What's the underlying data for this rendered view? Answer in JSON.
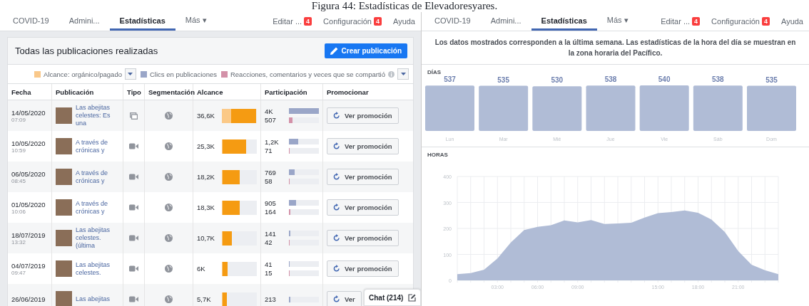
{
  "caption": "Figura 44: Estadísticas de Elevadoresyares.",
  "left": {
    "nav": {
      "tabs": [
        {
          "label": "COVID-19",
          "selected": false
        },
        {
          "label": "Admini...",
          "selected": false
        },
        {
          "label": "Estadísticas",
          "selected": true
        },
        {
          "label": "Más ▾",
          "selected": false
        }
      ],
      "actions": [
        {
          "label": "Editar ...",
          "badge": "4"
        },
        {
          "label": "Configuración",
          "badge": "4"
        },
        {
          "label": "Ayuda"
        }
      ]
    },
    "card": {
      "title": "Todas las publicaciones realizadas",
      "create_button": "Crear publicación",
      "legend": [
        {
          "label": "Alcance: orgánico/pagado",
          "color": "#f9c88a",
          "dropdown": true
        },
        {
          "label": "Clics en publicaciones",
          "color": "#9aa6c8",
          "dropdown": false
        },
        {
          "label": "Reacciones, comentarios y veces que se compartió",
          "color": "#d391a8",
          "info": true,
          "dropdown": true
        }
      ],
      "table": {
        "columns": [
          "Fecha",
          "Publicación",
          "Tipo",
          "Segmentación",
          "Alcance",
          "Participación",
          "Promocionar"
        ],
        "rows": [
          {
            "date": "14/05/2020",
            "time": "07:09",
            "title": "Las abejitas celestes: Es una",
            "kind": "album",
            "reach": "36,6K",
            "organic_bar": {
              "level": 0.26
            },
            "paid_bar": {
              "level": 0.72
            },
            "clicks": "4K",
            "clicks_bar": {
              "level": 1
            },
            "reactions": "507",
            "reactions_bar": {
              "level": 0.13
            },
            "button": "Ver promoción"
          },
          {
            "date": "10/05/2020",
            "time": "10:59",
            "title": "A través de crónicas y",
            "kind": "video",
            "reach": "25,3K",
            "organic_bar": {
              "level": 0.02
            },
            "paid_bar": {
              "level": 0.68
            },
            "clicks": "1,2K",
            "clicks_bar": {
              "level": 0.3
            },
            "reactions": "71",
            "reactions_bar": {
              "level": 0.02
            },
            "button": "Ver promoción"
          },
          {
            "date": "06/05/2020",
            "time": "08:45",
            "title": "A través de crónicas y",
            "kind": "video",
            "reach": "18,2K",
            "organic_bar": {
              "level": 0.02
            },
            "paid_bar": {
              "level": 0.48
            },
            "clicks": "769",
            "clicks_bar": {
              "level": 0.19
            },
            "reactions": "58",
            "reactions_bar": {
              "level": 0.02
            },
            "button": "Ver promoción"
          },
          {
            "date": "01/05/2020",
            "time": "10:06",
            "title": "A través de crónicas y",
            "kind": "video",
            "reach": "18,3K",
            "organic_bar": {
              "level": 0.02
            },
            "paid_bar": {
              "level": 0.48
            },
            "clicks": "905",
            "clicks_bar": {
              "level": 0.23
            },
            "reactions": "164",
            "reactions_bar": {
              "level": 0.04
            },
            "button": "Ver promoción"
          },
          {
            "date": "18/07/2019",
            "time": "13:32",
            "title": "Las abejitas celestes. (última",
            "kind": "video",
            "reach": "10,7K",
            "organic_bar": {
              "level": 0.02
            },
            "paid_bar": {
              "level": 0.27
            },
            "clicks": "141",
            "clicks_bar": {
              "level": 0.04
            },
            "reactions": "42",
            "reactions_bar": {
              "level": 0.02
            },
            "button": "Ver promoción"
          },
          {
            "date": "04/07/2019",
            "time": "09:47",
            "title": "Las abejitas celestes.",
            "kind": "video",
            "reach": "6K",
            "organic_bar": {
              "level": 0.02
            },
            "paid_bar": {
              "level": 0.14
            },
            "clicks": "41",
            "clicks_bar": {
              "level": 0.01
            },
            "reactions": "15",
            "reactions_bar": {
              "level": 0.01
            },
            "button": "Ver promoción"
          },
          {
            "date": "26/06/2019",
            "title": "Las abejitas",
            "kind": "video",
            "reach": "5,7K",
            "organic_bar": {
              "level": 0.02
            },
            "paid_bar": {
              "level": 0.13
            },
            "clicks": "213",
            "clicks_bar": {
              "level": 0.05
            },
            "button": "Ver"
          }
        ]
      }
    },
    "chat": {
      "label": "Chat (214)"
    }
  },
  "right": {
    "nav": {
      "tabs": [
        {
          "label": "COVID-19",
          "selected": false
        },
        {
          "label": "Admini...",
          "selected": false
        },
        {
          "label": "Estadísticas",
          "selected": true
        },
        {
          "label": "Más ▾",
          "selected": false
        }
      ],
      "actions": [
        {
          "label": "Editar ...",
          "badge": "4"
        },
        {
          "label": "Configuración",
          "badge": "4"
        },
        {
          "label": "Ayuda"
        }
      ]
    },
    "notice": "Los datos mostrados corresponden a la última semana. Las estadísticas de la hora del día se muestran en la zona horaria del Pacífico.",
    "days": {
      "chart_data": {
        "type": "bar",
        "categories": [
          "Lun",
          "Mar",
          "Mié",
          "Jue",
          "Vie",
          "Sáb",
          "Dom"
        ],
        "series": [
          {
            "name": "DÍAS",
            "color": "#b0bcd6",
            "values": [
              537,
              535,
              530,
              538,
              540,
              538,
              535
            ]
          }
        ],
        "data_labels": true
      }
    },
    "hours": {
      "chart_data": {
        "type": "area",
        "grid": true,
        "x": [
          0,
          1,
          2,
          3,
          4,
          5,
          6,
          7,
          8,
          9,
          10,
          11,
          12,
          13,
          14,
          15,
          16,
          17,
          18,
          19,
          20,
          21,
          22,
          23,
          24
        ],
        "series": [
          {
            "name": "HORAS",
            "color": "#b0bcd6",
            "values": [
              24,
              28,
              41,
              84,
              146,
              194,
              206,
              212,
              231,
              223,
              232,
              217,
              219,
              222,
              242,
              259,
              263,
              269,
              260,
              234,
              186,
              113,
              60,
              39,
              24
            ]
          }
        ],
        "xlim": [
          0,
          24
        ],
        "ylim": [
          0,
          400
        ],
        "yticks": [
          0,
          100,
          200,
          300,
          400
        ],
        "xticks": [
          {
            "value": 3,
            "label": "03:00"
          },
          {
            "value": 6,
            "label": "06:00"
          },
          {
            "value": 9,
            "label": "09:00"
          },
          {
            "value": 15,
            "label": "15:00"
          },
          {
            "value": 18,
            "label": "18:00"
          },
          {
            "value": 21,
            "label": "21:00"
          }
        ]
      }
    }
  }
}
